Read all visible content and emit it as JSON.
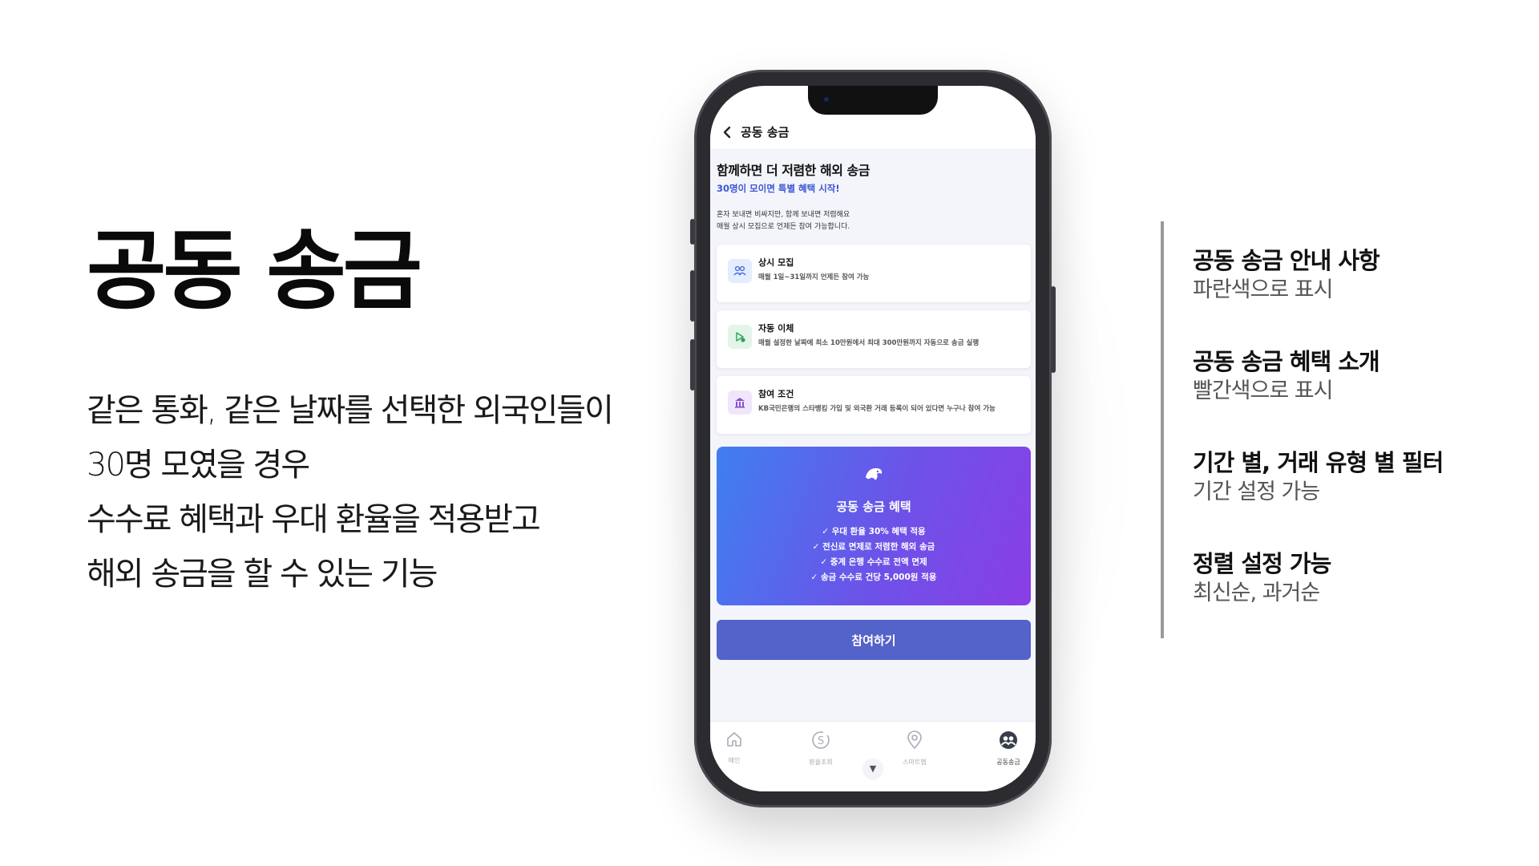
{
  "slide": {
    "title": "공동 송금",
    "description": [
      "같은 통화, 같은 날짜를 선택한 외국인들이",
      "30명 모였을 경우",
      "수수료 혜택과 우대 환율을 적용받고",
      "해외 송금을 할 수 있는 기능"
    ]
  },
  "app": {
    "header": {
      "back_icon": "chevron-left-icon",
      "title": "공동 송금"
    },
    "hero": {
      "title": "함께하면 더 저렴한 해외 송금",
      "subtitle": "30명이 모이면 특별 혜택 시작!",
      "desc_line1": "혼자 보내면 비싸지만, 함께 보내면 저렴해요",
      "desc_line2": "매월 상시 모집으로 언제든 참여 가능합니다."
    },
    "cards": [
      {
        "icon": "people-icon",
        "title": "상시 모집",
        "desc": "매월 1일~31일까지 언제든 참여 가능"
      },
      {
        "icon": "auto-transfer-icon",
        "title": "자동 이체",
        "desc": "매월 설정한 날짜에 최소 10만원에서 최대 300만원까지 자동으로 송금 실행"
      },
      {
        "icon": "bank-icon",
        "title": "참여 조건",
        "desc": "KB국민은행의 스타뱅킹 가입 및 외국환 거래 등록이 되어 있다면 누구나 참여 가능"
      }
    ],
    "benefit": {
      "icon": "dolphin-icon",
      "title": "공동 송금 혜택",
      "items": [
        "✓ 우대 환율 30% 혜택 적용",
        "✓ 전신료 면제로 저렴한 해외 송금",
        "✓ 중계 은행 수수료 전액 면제",
        "✓ 송금 수수료 건당 5,000원 적용"
      ],
      "gradient_start": "#3f7ff0",
      "gradient_end": "#8a3ee6"
    },
    "join_button": "참여하기",
    "tabbar": [
      {
        "icon": "home-icon",
        "label": "메인"
      },
      {
        "icon": "exchange-rate-icon",
        "label": "환율조회"
      },
      {
        "icon": "map-pin-icon",
        "label": "스마트맵"
      },
      {
        "icon": "group-icon",
        "label": "공동송금",
        "active": true
      }
    ],
    "accent_color": "#3b56d4",
    "button_color": "#5463c9"
  },
  "notes": [
    {
      "title": "공동 송금 안내 사항",
      "sub": "파란색으로 표시"
    },
    {
      "title": "공동 송금 혜택 소개",
      "sub": "빨간색으로 표시"
    },
    {
      "title": "기간 별, 거래 유형 별 필터",
      "sub": "기간 설정 가능"
    },
    {
      "title": "정렬 설정 가능",
      "sub": "최신순, 과거순"
    }
  ]
}
